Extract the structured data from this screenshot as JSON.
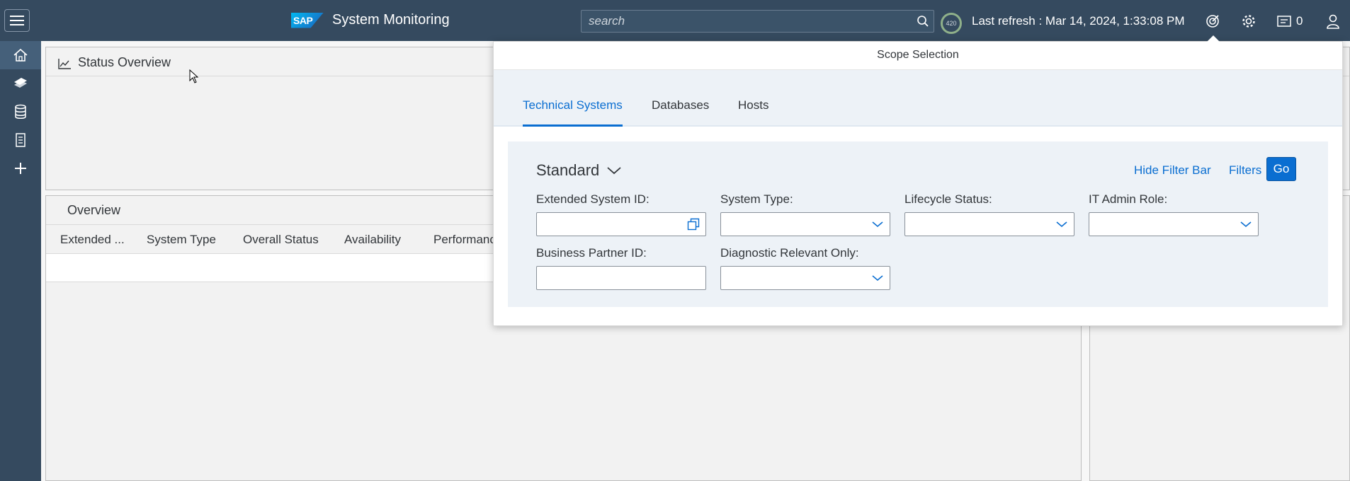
{
  "header": {
    "app_title": "System Monitoring",
    "logo_text": "SAP",
    "search_placeholder": "search",
    "refresh_badge": "420",
    "last_refresh": "Last refresh : Mar 14, 2024, 1:33:08 PM",
    "notification_count": "0"
  },
  "side_nav": {
    "items": [
      {
        "name": "home-icon"
      },
      {
        "name": "systems-icon"
      },
      {
        "name": "database-icon"
      },
      {
        "name": "document-icon"
      },
      {
        "name": "add-icon"
      }
    ]
  },
  "status_overview": {
    "title": "Status Overview"
  },
  "overview": {
    "title": "Overview",
    "columns": [
      "Extended ...",
      "System Type",
      "Overall Status",
      "Availability",
      "Performance"
    ]
  },
  "scope_selection": {
    "title": "Scope Selection",
    "tabs": [
      "Technical Systems",
      "Databases",
      "Hosts"
    ],
    "selected_tab": "Technical Systems",
    "variant": "Standard",
    "hide_filter_bar": "Hide Filter Bar",
    "filters": "Filters",
    "go": "Go",
    "fields": {
      "extended_system_id": "Extended System ID:",
      "system_type": "System Type:",
      "lifecycle_status": "Lifecycle Status:",
      "it_admin_role": "IT Admin Role:",
      "business_partner_id": "Business Partner ID:",
      "diagnostic_relevant_only": "Diagnostic Relevant Only:"
    }
  },
  "colors": {
    "shell": "#354a5f",
    "accent": "#0a6ed1",
    "filter_bar_bg": "#edf2f7"
  }
}
